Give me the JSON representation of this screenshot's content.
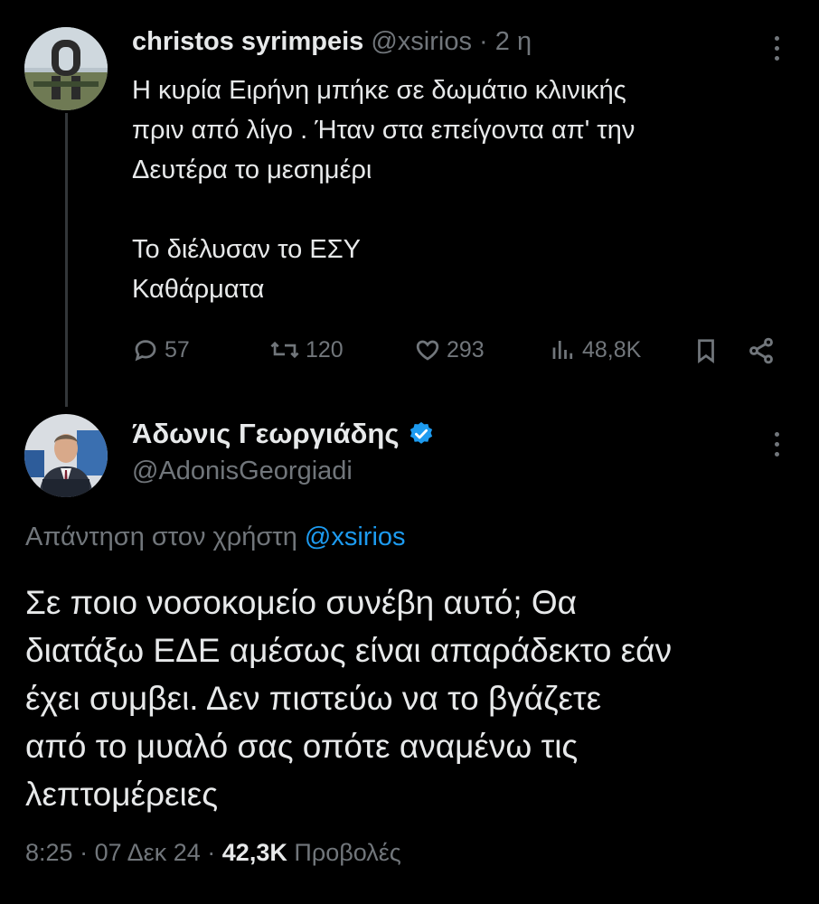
{
  "tweet1": {
    "display_name": "christos syrimpeis",
    "handle": "@xsirios",
    "separator": "·",
    "time": "2 η",
    "lines": [
      "Η κυρία Ειρήνη μπήκε σε δωμάτιο κλινικής",
      "πριν από λίγο . Ήταν στα επείγοντα απ' την",
      "Δευτέρα το μεσημέρι",
      "",
      "Το διέλυσαν το ΕΣΥ",
      "Καθάρματα"
    ],
    "stats": {
      "replies": "57",
      "retweets": "120",
      "likes": "293",
      "views": "48,8K"
    }
  },
  "tweet2": {
    "display_name": "Άδωνις Γεωργιάδης",
    "handle": "@AdonisGeorgiadi",
    "reply_prefix": "Απάντηση στον χρήστη",
    "reply_mention": "@xsirios",
    "lines": [
      "Σε ποιο νοσοκομείο συνέβη αυτό; Θα",
      "διατάξω ΕΔΕ αμέσως είναι απαράδεκτο εάν",
      "έχει συμβει. Δεν πιστεύω να το βγάζετε",
      "από το μυαλό σας οπότε αναμένω τις",
      "λεπτομέρειες"
    ],
    "time": "8:25",
    "separator1": "·",
    "date": "07 Δεκ 24",
    "separator2": "·",
    "views_count": "42,3K",
    "views_label": "Προβολές"
  },
  "colors": {
    "background": "#000000",
    "text": "#e7e9ea",
    "muted": "#71767b",
    "link": "#1d9bf0",
    "verified": "#1d9bf0"
  },
  "icons": [
    "reply-icon",
    "retweet-icon",
    "like-icon",
    "views-icon",
    "bookmark-icon",
    "share-icon",
    "more-icon",
    "verified-badge-icon"
  ]
}
